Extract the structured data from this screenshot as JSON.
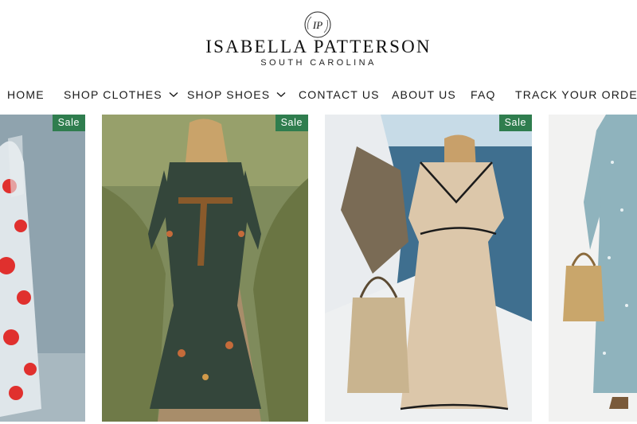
{
  "brand": {
    "monogram": "IP",
    "name": "ISABELLA PATTERSON",
    "location": "SOUTH CAROLINA"
  },
  "nav": {
    "items": [
      {
        "label": "HOME",
        "has_dropdown": false
      },
      {
        "label": "SHOP CLOTHES",
        "has_dropdown": true
      },
      {
        "label": "SHOP SHOES",
        "has_dropdown": true
      },
      {
        "label": "CONTACT US",
        "has_dropdown": false
      },
      {
        "label": "ABOUT US",
        "has_dropdown": false
      },
      {
        "label": "FAQ",
        "has_dropdown": false
      },
      {
        "label": "TRACK YOUR ORDER",
        "has_dropdown": false
      }
    ]
  },
  "products": [
    {
      "badge": "Sale"
    },
    {
      "badge": "Sale"
    },
    {
      "badge": "Sale"
    },
    {
      "badge": ""
    }
  ],
  "colors": {
    "sale_badge": "#2f7d4e",
    "text": "#1a1a1a"
  }
}
